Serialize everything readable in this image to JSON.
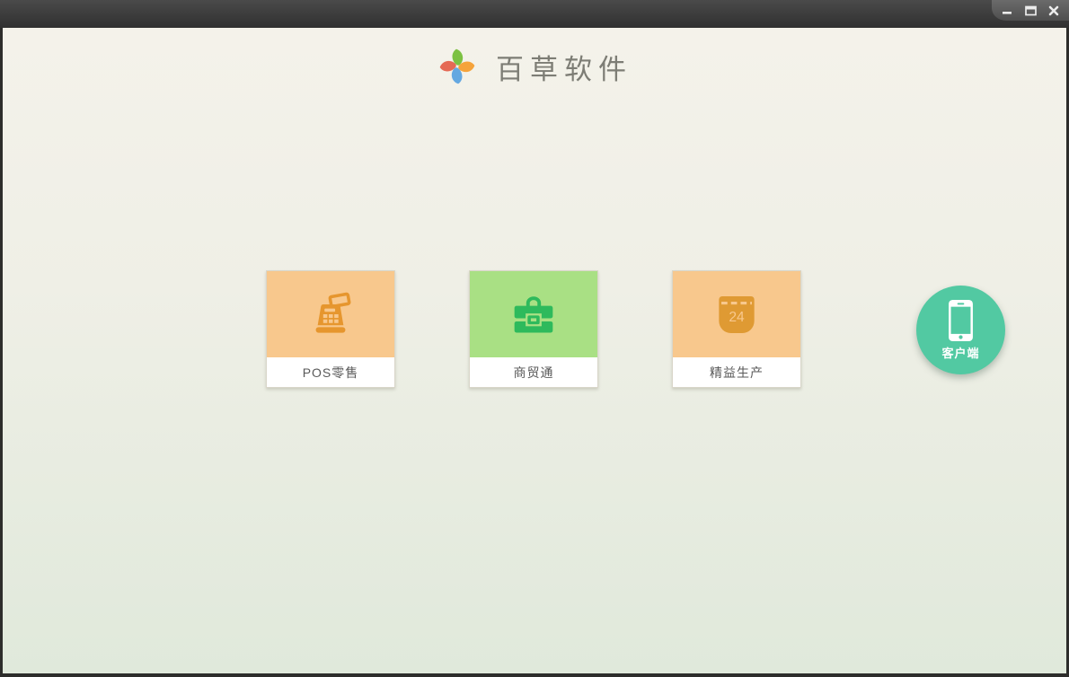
{
  "window": {
    "controls": [
      {
        "name": "minimize"
      },
      {
        "name": "maximize"
      },
      {
        "name": "close"
      }
    ]
  },
  "header": {
    "brand": "百草软件",
    "logo": "pinwheel-logo",
    "logo_petal_colors": {
      "top_green": "#7cc142",
      "right_orange": "#f5a33b",
      "bottom_blue": "#64a8e1",
      "left_red": "#e56a55"
    }
  },
  "products": [
    {
      "label": "POS零售",
      "icon": "cash-register-icon",
      "tile_color": "#f8c88d",
      "icon_color": "#e6962e"
    },
    {
      "label": "商贸通",
      "icon": "briefcase-icon",
      "tile_color": "#a9e084",
      "icon_color": "#2eba5c"
    },
    {
      "label": "精益生产",
      "icon": "calendar-icon",
      "calendar_day": "24",
      "tile_color": "#f8c88d",
      "icon_color": "#df9a33"
    }
  ],
  "client_button": {
    "label": "客户端",
    "icon": "smartphone-icon",
    "color": "#52c9a2"
  },
  "theme": {
    "titlebar_top": "#4a4a4a",
    "titlebar_bottom": "#303030",
    "background_top": "#f4f2ea",
    "background_bottom": "#e0e9db",
    "card_label_text": "#595959",
    "brand_text": "#7d7d75"
  }
}
